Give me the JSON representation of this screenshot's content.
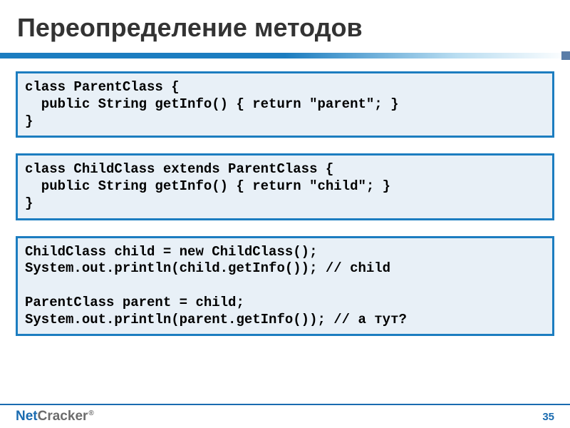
{
  "title": "Переопределение методов",
  "code_blocks": [
    "class ParentClass {\n  public String getInfo() { return \"parent\"; }\n}",
    "class ChildClass extends ParentClass {\n  public String getInfo() { return \"child\"; }\n}",
    "ChildClass child = new ChildClass();\nSystem.out.println(child.getInfo()); // child\n\nParentClass parent = child;\nSystem.out.println(parent.getInfo()); // а тут?"
  ],
  "footer": {
    "logo_net": "Net",
    "logo_cracker": "Cracker",
    "reg": "®",
    "page": "35"
  }
}
